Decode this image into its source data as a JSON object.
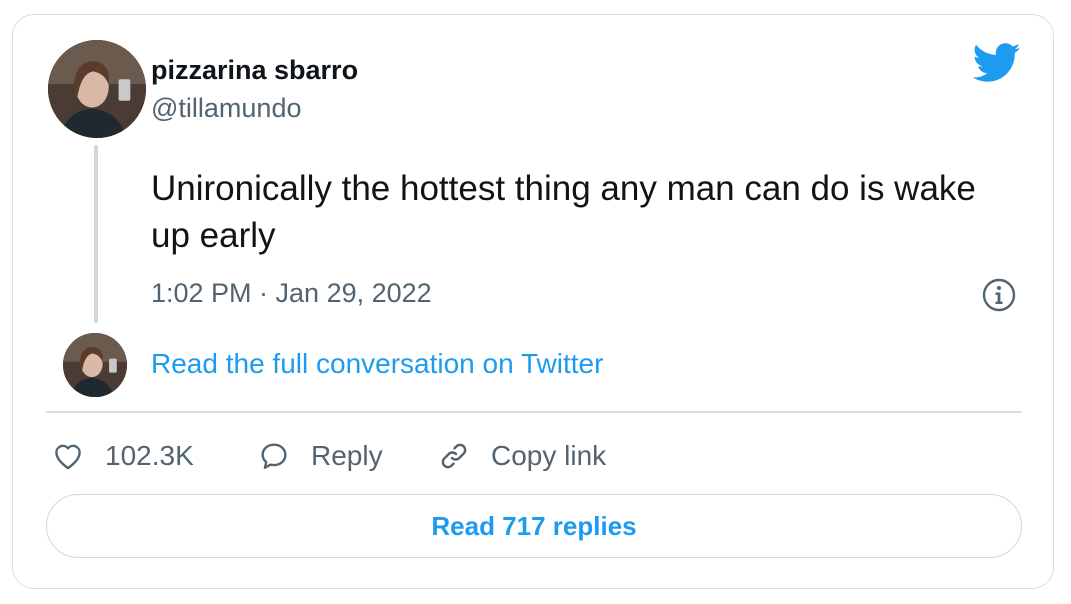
{
  "author": {
    "display_name": "pizzarina sbarro",
    "handle": "@tillamundo"
  },
  "tweet": {
    "text": "Unironically the hottest thing any man can do is wake up early",
    "timestamp": "1:02 PM · Jan 29, 2022"
  },
  "conversation_link": "Read the full conversation on Twitter",
  "actions": {
    "like_count": "102.3K",
    "reply_label": "Reply",
    "copy_link_label": "Copy link"
  },
  "read_replies_label": "Read 717 replies",
  "colors": {
    "accent": "#1d9bf0",
    "secondary_text": "#536471",
    "primary_text": "#0f1419",
    "border": "#d9dde0"
  },
  "icons": {
    "brand": "twitter-bird-icon",
    "info": "info-icon",
    "like": "heart-icon",
    "reply": "speech-bubble-icon",
    "copy": "link-icon"
  }
}
